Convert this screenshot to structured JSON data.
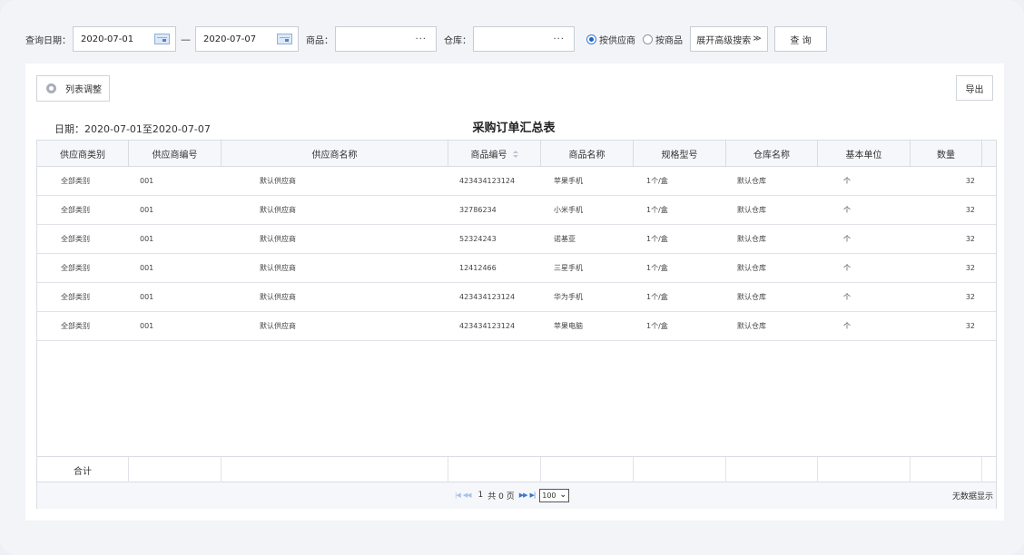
{
  "filters": {
    "date_label": "查询日期：",
    "date_from": "2020-07-01",
    "date_sep": "—",
    "date_to": "2020-07-07",
    "goods_label": "商品：",
    "goods_value": "",
    "warehouse_label": "仓库：",
    "warehouse_value": "",
    "lookup_glyph": "···",
    "radio_supplier": "按供应商",
    "radio_goods": "按商品",
    "advanced_button": "展开高级搜索",
    "advanced_glyph": "≫",
    "query_button": "查 询"
  },
  "toolbar": {
    "list_adjust": "列表调整",
    "export": "导出"
  },
  "report": {
    "date_range": "日期：2020-07-01至2020-07-07",
    "title": "采购订单汇总表"
  },
  "table": {
    "headers": [
      "供应商类别",
      "供应商编号",
      "供应商名称",
      "商品编号",
      "商品名称",
      "规格型号",
      "仓库名称",
      "基本单位",
      "数量"
    ],
    "rows": [
      [
        "全部类别",
        "001",
        "默认供应商",
        "423434123124",
        "苹果手机",
        "1个/盒",
        "默认仓库",
        "个",
        "32"
      ],
      [
        "全部类别",
        "001",
        "默认供应商",
        "32786234",
        "小米手机",
        "1个/盒",
        "默认仓库",
        "个",
        "32"
      ],
      [
        "全部类别",
        "001",
        "默认供应商",
        "52324243",
        "诺基亚",
        "1个/盒",
        "默认仓库",
        "个",
        "32"
      ],
      [
        "全部类别",
        "001",
        "默认供应商",
        "12412466",
        "三星手机",
        "1个/盒",
        "默认仓库",
        "个",
        "32"
      ],
      [
        "全部类别",
        "001",
        "默认供应商",
        "423434123124",
        "华为手机",
        "1个/盒",
        "默认仓库",
        "个",
        "32"
      ],
      [
        "全部类别",
        "001",
        "默认供应商",
        "423434123124",
        "苹果电脑",
        "1个/盒",
        "默认仓库",
        "个",
        "32"
      ]
    ],
    "total_label": "合计"
  },
  "pager": {
    "first": "|◀",
    "prev": "◀◀",
    "page_input": "1",
    "page_total": "共 0 页",
    "next": "▶▶",
    "last": "▶|",
    "page_size": "100",
    "select_arrow": "⌄",
    "status": "无数据显示"
  }
}
